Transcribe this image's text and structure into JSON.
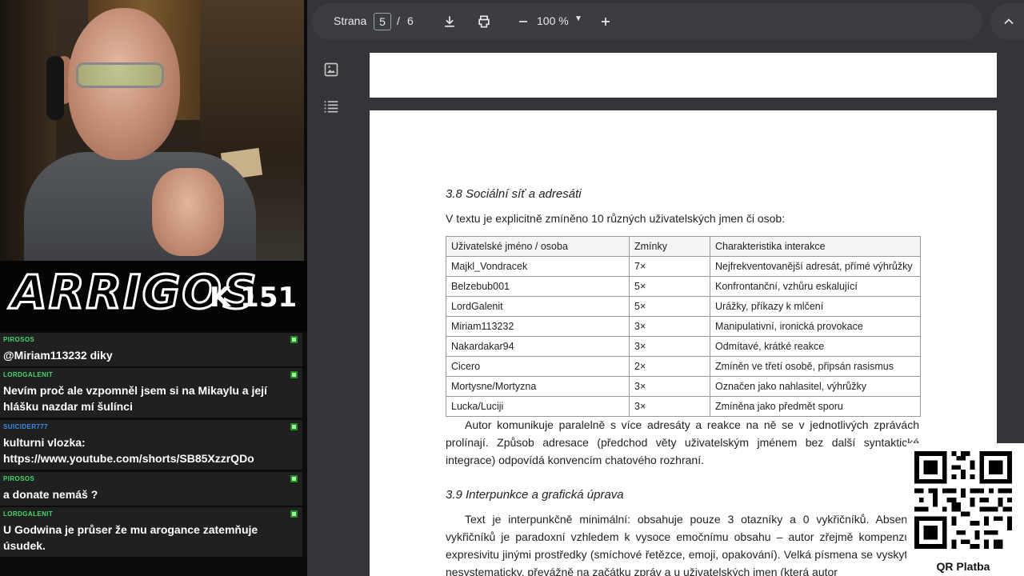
{
  "stream": {
    "brand": {
      "logo": "ARRIGOS",
      "subtitle": "K 151"
    },
    "chat": [
      {
        "user": "PIROSOS",
        "user_color": "#43d96b",
        "text": "@Miriam113232 diky"
      },
      {
        "user": "LORDGALENIT",
        "user_color": "#43d96b",
        "text": "Nevím proč ale vzpomněl jsem si na Mikaylu a její hlášku nazdar mí šulínci"
      },
      {
        "user": "SUICIDER777",
        "user_color": "#3a8fe8",
        "text": "kulturni vlozka: https://www.youtube.com/shorts/SB85XzzrQDo"
      },
      {
        "user": "PIROSOS",
        "user_color": "#43d96b",
        "text": "a donate nemáš ?"
      },
      {
        "user": "LORDGALENIT",
        "user_color": "#43d96b",
        "text": "U Godwina je průser že mu arogance zatemňuje úsudek."
      }
    ]
  },
  "viewer": {
    "toolbar": {
      "page_label": "Strana",
      "current_page": "5",
      "separator": "/",
      "total_pages": "6",
      "zoom": "100 %"
    },
    "icons": [
      "download-icon",
      "print-icon",
      "zoom-out-icon",
      "zoom-in-icon",
      "collapse-icon",
      "thumbnail-icon",
      "outline-icon"
    ],
    "document": {
      "section_38_title": "3.8 Sociální síť a adresáti",
      "section_38_intro": "V textu je explicitně zmíněno 10 různých uživatelských jmen či osob:",
      "table": {
        "headers": [
          "Uživatelské jméno / osoba",
          "Zmínky",
          "Charakteristika interakce"
        ],
        "rows": [
          [
            "Majkl_Vondracek",
            "7×",
            "Nejfrekventovanější adresát, přímé výhrůžky"
          ],
          [
            "Belzebub001",
            "5×",
            "Konfrontanční, vzhůru eskalující"
          ],
          [
            "LordGalenit",
            "5×",
            "Urážky, příkazy k mlčení"
          ],
          [
            "Miriam113232",
            "3×",
            "Manipulativní, ironická provokace"
          ],
          [
            "Nakardakar94",
            "3×",
            "Odmítavé, krátké reakce"
          ],
          [
            "Cicero",
            "2×",
            "Zmíněn ve třetí osobě, připsán rasismus"
          ],
          [
            "Mortysne/Mortyzna",
            "3×",
            "Označen jako nahlasitel, výhrůžky"
          ],
          [
            "Lucka/Luciji",
            "3×",
            "Zmíněna jako předmět sporu"
          ]
        ]
      },
      "para_after_table": "Autor komunikuje paralelně s více adresáty a reakce na ně se v jednotlivých zprávách prolínají. Způsob adresace (předchod věty uživatelským jménem bez další syntaktické integrace) odpovídá konvencím chatového rozhraní.",
      "section_39_title": "3.9 Interpunkce a grafická úprava",
      "section_39_para": "Text je interpunkčně minimální: obsahuje pouze 3 otazníky a 0 vykřičníků. Absence vykřičníků je paradoxní vzhledem k vysoce emočnímu obsahu – autor zřejmě kompenzuje expresivitu jinými prostředky (smíchové řetězce, emoji, opakování). Velká písmena se vyskytují nesystematicky, převážně na začátku zpráv a u uživatelských jmen (která autor"
    }
  },
  "qr_overlay": {
    "label": "QR Platba"
  },
  "colors": {
    "viewer_bg": "#333538",
    "toolbar_bg": "#3c3d40",
    "chat_bg": "#202020"
  }
}
